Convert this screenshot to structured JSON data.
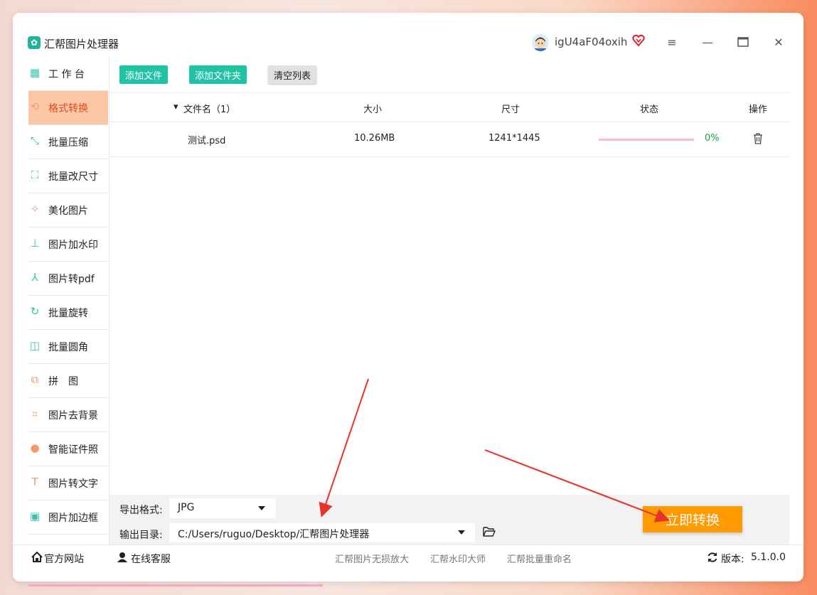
{
  "app": {
    "title": "汇帮图片处理器",
    "username": "igU4aF04oxih"
  },
  "sidebar": {
    "items": [
      {
        "label": "工 作 台",
        "icon": "grid-icon"
      },
      {
        "label": "格式转换",
        "icon": "convert-icon",
        "active": true
      },
      {
        "label": "批量压缩",
        "icon": "compress-icon"
      },
      {
        "label": "批量改尺寸",
        "icon": "resize-icon"
      },
      {
        "label": "美化图片",
        "icon": "beautify-icon"
      },
      {
        "label": "图片加水印",
        "icon": "watermark-icon"
      },
      {
        "label": "图片转pdf",
        "icon": "pdf-icon"
      },
      {
        "label": "批量旋转",
        "icon": "rotate-icon"
      },
      {
        "label": "批量圆角",
        "icon": "round-corner-icon"
      },
      {
        "label": "拼　图",
        "icon": "puzzle-icon"
      },
      {
        "label": "图片去背景",
        "icon": "crop-icon"
      },
      {
        "label": "智能证件照",
        "icon": "person-icon"
      },
      {
        "label": "图片转文字",
        "icon": "text-icon"
      },
      {
        "label": "图片加边框",
        "icon": "frame-icon"
      }
    ]
  },
  "toolbar": {
    "add_file": "添加文件",
    "add_folder": "添加文件夹",
    "clear_list": "清空列表"
  },
  "table": {
    "headers": {
      "name": "文件名（1）",
      "size": "大小",
      "dimensions": "尺寸",
      "status": "状态",
      "action": "操作"
    },
    "rows": [
      {
        "name": "测试.psd",
        "size": "10.26MB",
        "dimensions": "1241*1445",
        "progress": 0,
        "percent": "0%"
      }
    ]
  },
  "settings": {
    "format_label": "导出格式:",
    "format_value": "JPG",
    "dir_label": "输出目录:",
    "dir_value": "C:/Users/ruguo/Desktop/汇帮图片处理器"
  },
  "convert_button": "立即转换",
  "footer": {
    "website": "官方网站",
    "support": "在线客服",
    "links": [
      "汇帮图片无损放大",
      "汇帮水印大师",
      "汇帮批量重命名"
    ],
    "version_label": "版本:",
    "version": "5.1.0.0"
  },
  "colors": {
    "accent": "#21c3a5",
    "active_bg": "#fbc7a7",
    "convert": "#ff9a00",
    "arrow": "#e8322a"
  }
}
